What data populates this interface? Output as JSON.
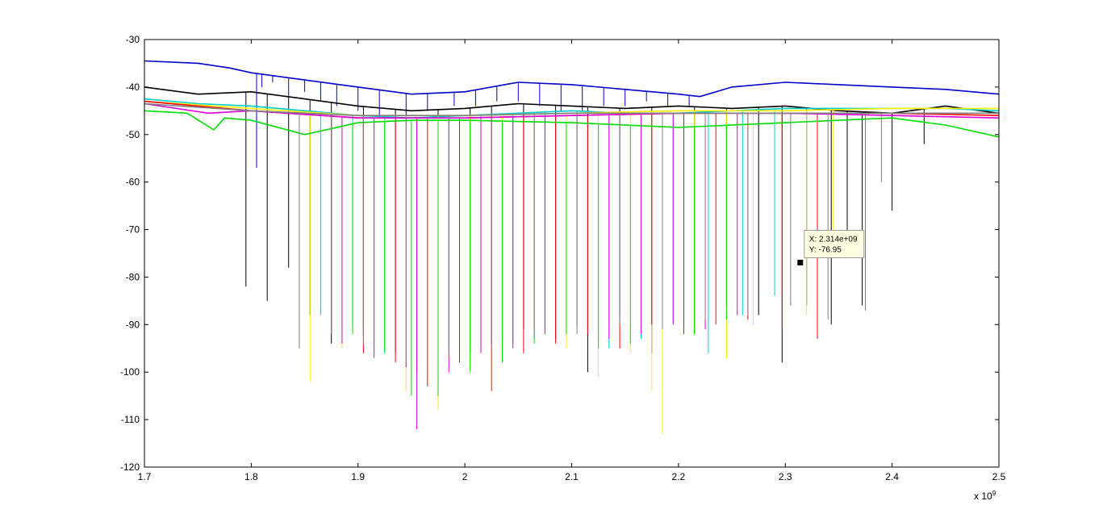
{
  "chart_data": {
    "type": "line",
    "title": "",
    "xlabel": "",
    "ylabel": "",
    "xlim": [
      1.7,
      2.5
    ],
    "ylim": [
      -120,
      -30
    ],
    "x_exponent_label": "x 10",
    "x_exponent_power": "9",
    "x_ticks": [
      "1.7",
      "1.8",
      "1.9",
      "2",
      "2.1",
      "2.2",
      "2.3",
      "2.4",
      "2.5"
    ],
    "y_ticks": [
      "-30",
      "-40",
      "-50",
      "-60",
      "-70",
      "-80",
      "-90",
      "-100",
      "-110",
      "-120"
    ],
    "grid": false,
    "legend": "none",
    "series": [
      {
        "color": "#0000cc",
        "baseline": [
          [
            1.7,
            -34.5
          ],
          [
            1.75,
            -35.0
          ],
          [
            1.78,
            -36.0
          ],
          [
            1.8,
            -37.0
          ],
          [
            1.85,
            -38.5
          ],
          [
            1.9,
            -40.0
          ],
          [
            1.95,
            -41.5
          ],
          [
            2.0,
            -41.0
          ],
          [
            2.05,
            -39.0
          ],
          [
            2.1,
            -39.5
          ],
          [
            2.15,
            -40.5
          ],
          [
            2.2,
            -41.5
          ],
          [
            2.22,
            -42.0
          ],
          [
            2.25,
            -40.0
          ],
          [
            2.3,
            -39.0
          ],
          [
            2.35,
            -39.5
          ],
          [
            2.4,
            -40.0
          ],
          [
            2.45,
            -40.5
          ],
          [
            2.5,
            -41.5
          ]
        ],
        "dips": [
          [
            1.805,
            -57
          ],
          [
            1.81,
            -40
          ],
          [
            1.82,
            -39
          ],
          [
            1.835,
            -42
          ],
          [
            1.85,
            -41
          ],
          [
            1.865,
            -43
          ],
          [
            1.88,
            -44
          ],
          [
            1.9,
            -45
          ],
          [
            1.92,
            -46
          ],
          [
            1.945,
            -46
          ],
          [
            1.965,
            -45
          ],
          [
            1.99,
            -44
          ],
          [
            2.01,
            -44
          ],
          [
            2.03,
            -43
          ],
          [
            2.05,
            -43
          ],
          [
            2.07,
            -44
          ],
          [
            2.09,
            -45
          ],
          [
            2.11,
            -45
          ],
          [
            2.13,
            -44
          ],
          [
            2.15,
            -44
          ],
          [
            2.17,
            -43
          ],
          [
            2.19,
            -44
          ],
          [
            2.21,
            -44
          ]
        ]
      },
      {
        "color": "#000000",
        "baseline": [
          [
            1.7,
            -40.0
          ],
          [
            1.75,
            -41.5
          ],
          [
            1.8,
            -41.0
          ],
          [
            1.85,
            -42.5
          ],
          [
            1.9,
            -44.0
          ],
          [
            1.95,
            -45.0
          ],
          [
            2.0,
            -44.5
          ],
          [
            2.05,
            -43.5
          ],
          [
            2.1,
            -44.0
          ],
          [
            2.15,
            -44.5
          ],
          [
            2.2,
            -44.0
          ],
          [
            2.25,
            -44.5
          ],
          [
            2.3,
            -44.0
          ],
          [
            2.35,
            -45.0
          ],
          [
            2.4,
            -45.5
          ],
          [
            2.45,
            -44.0
          ],
          [
            2.5,
            -45.5
          ]
        ],
        "dips": [
          [
            1.795,
            -82
          ],
          [
            1.815,
            -85
          ],
          [
            1.835,
            -78
          ],
          [
            1.855,
            -88
          ],
          [
            1.875,
            -94
          ],
          [
            1.905,
            -92
          ],
          [
            1.935,
            -96
          ],
          [
            1.975,
            -101
          ],
          [
            2.005,
            -96
          ],
          [
            2.025,
            -94
          ],
          [
            2.055,
            -91
          ],
          [
            2.085,
            -93
          ],
          [
            2.115,
            -100
          ],
          [
            2.145,
            -88
          ],
          [
            2.175,
            -96
          ],
          [
            2.215,
            -92
          ],
          [
            2.245,
            -86
          ],
          [
            2.275,
            -88
          ],
          [
            2.297,
            -98
          ],
          [
            2.32,
            -86
          ],
          [
            2.343,
            -90
          ],
          [
            2.358,
            -76
          ],
          [
            2.372,
            -86
          ],
          [
            2.4,
            -66
          ],
          [
            2.43,
            -52
          ]
        ]
      },
      {
        "color": "#00cccc",
        "baseline": [
          [
            1.7,
            -42.5
          ],
          [
            1.75,
            -43.5
          ],
          [
            1.8,
            -44.0
          ],
          [
            1.85,
            -45.0
          ],
          [
            1.9,
            -46.0
          ],
          [
            1.95,
            -46.5
          ],
          [
            2.0,
            -46.0
          ],
          [
            2.05,
            -45.5
          ],
          [
            2.1,
            -45.0
          ],
          [
            2.15,
            -45.5
          ],
          [
            2.2,
            -45.5
          ],
          [
            2.25,
            -45.0
          ],
          [
            2.3,
            -44.5
          ],
          [
            2.35,
            -44.5
          ],
          [
            2.4,
            -44.5
          ],
          [
            2.45,
            -44.5
          ],
          [
            2.5,
            -45.0
          ]
        ],
        "dips": [
          [
            1.865,
            -88
          ],
          [
            1.895,
            -90
          ],
          [
            1.925,
            -96
          ],
          [
            1.955,
            -98
          ],
          [
            1.985,
            -95
          ],
          [
            2.015,
            -92
          ],
          [
            2.045,
            -94
          ],
          [
            2.075,
            -91
          ],
          [
            2.105,
            -89
          ],
          [
            2.135,
            -95
          ],
          [
            2.165,
            -93
          ],
          [
            2.195,
            -90
          ],
          [
            2.228,
            -96
          ],
          [
            2.26,
            -88
          ],
          [
            2.29,
            -84
          ]
        ]
      },
      {
        "color": "#ffee00",
        "baseline": [
          [
            1.7,
            -43.0
          ],
          [
            1.8,
            -44.5
          ],
          [
            1.9,
            -46.0
          ],
          [
            2.0,
            -46.0
          ],
          [
            2.1,
            -45.5
          ],
          [
            2.2,
            -45.0
          ],
          [
            2.3,
            -45.0
          ],
          [
            2.4,
            -44.5
          ],
          [
            2.5,
            -44.5
          ]
        ],
        "dips": [
          [
            1.855,
            -102
          ],
          [
            1.885,
            -95
          ],
          [
            1.915,
            -97
          ],
          [
            1.945,
            -104
          ],
          [
            1.975,
            -108
          ],
          [
            2.005,
            -99
          ],
          [
            2.035,
            -96
          ],
          [
            2.065,
            -91
          ],
          [
            2.095,
            -95
          ],
          [
            2.125,
            -101
          ],
          [
            2.155,
            -96
          ],
          [
            2.175,
            -104
          ],
          [
            2.185,
            -113
          ],
          [
            2.215,
            -92
          ],
          [
            2.245,
            -97
          ],
          [
            2.27,
            -90
          ],
          [
            2.32,
            -88
          ],
          [
            2.345,
            -70
          ]
        ]
      },
      {
        "color": "#ff0000",
        "baseline": [
          [
            1.7,
            -43.0
          ],
          [
            1.8,
            -45.0
          ],
          [
            1.9,
            -46.5
          ],
          [
            2.0,
            -46.5
          ],
          [
            2.1,
            -46.0
          ],
          [
            2.2,
            -45.5
          ],
          [
            2.3,
            -45.5
          ],
          [
            2.4,
            -45.5
          ],
          [
            2.5,
            -46.0
          ]
        ],
        "dips": [
          [
            1.875,
            -92
          ],
          [
            1.905,
            -96
          ],
          [
            1.935,
            -98
          ],
          [
            1.955,
            -100
          ],
          [
            1.965,
            -103
          ],
          [
            1.995,
            -98
          ],
          [
            2.025,
            -104
          ],
          [
            2.055,
            -96
          ],
          [
            2.085,
            -94
          ],
          [
            2.115,
            -92
          ],
          [
            2.145,
            -95
          ],
          [
            2.175,
            -90
          ],
          [
            2.205,
            -92
          ],
          [
            2.235,
            -90
          ],
          [
            2.265,
            -89
          ],
          [
            2.297,
            -91
          ],
          [
            2.33,
            -93
          ]
        ]
      },
      {
        "color": "#dd00dd",
        "baseline": [
          [
            1.7,
            -43.5
          ],
          [
            1.76,
            -45.5
          ],
          [
            1.8,
            -45.0
          ],
          [
            1.9,
            -46.5
          ],
          [
            2.0,
            -46.5
          ],
          [
            2.1,
            -46.0
          ],
          [
            2.2,
            -45.5
          ],
          [
            2.3,
            -45.5
          ],
          [
            2.4,
            -46.0
          ],
          [
            2.5,
            -46.5
          ]
        ],
        "dips": [
          [
            1.885,
            -94
          ],
          [
            1.915,
            -97
          ],
          [
            1.945,
            -99
          ],
          [
            1.955,
            -112
          ],
          [
            1.985,
            -100
          ],
          [
            2.015,
            -96
          ],
          [
            2.045,
            -95
          ],
          [
            2.075,
            -92
          ],
          [
            2.105,
            -90
          ],
          [
            2.135,
            -93
          ],
          [
            2.165,
            -92
          ],
          [
            2.195,
            -90
          ],
          [
            2.225,
            -91
          ],
          [
            2.255,
            -88
          ]
        ]
      },
      {
        "color": "#00dd00",
        "baseline": [
          [
            1.7,
            -45.0
          ],
          [
            1.74,
            -45.5
          ],
          [
            1.765,
            -49.0
          ],
          [
            1.775,
            -46.5
          ],
          [
            1.8,
            -47.0
          ],
          [
            1.85,
            -50.0
          ],
          [
            1.9,
            -47.5
          ],
          [
            1.95,
            -47.0
          ],
          [
            2.0,
            -47.0
          ],
          [
            2.1,
            -47.5
          ],
          [
            2.2,
            -48.5
          ],
          [
            2.3,
            -47.5
          ],
          [
            2.35,
            -47.0
          ],
          [
            2.4,
            -46.5
          ],
          [
            2.45,
            -48.0
          ],
          [
            2.5,
            -50.5
          ]
        ],
        "dips": [
          [
            1.895,
            -92
          ],
          [
            1.925,
            -96
          ],
          [
            1.95,
            -105
          ],
          [
            1.975,
            -105
          ],
          [
            2.005,
            -100
          ],
          [
            2.035,
            -98
          ],
          [
            2.065,
            -94
          ],
          [
            2.095,
            -92
          ],
          [
            2.125,
            -95
          ],
          [
            2.155,
            -94
          ],
          [
            2.185,
            -91
          ],
          [
            2.215,
            -92
          ],
          [
            2.245,
            -89
          ]
        ]
      },
      {
        "color": "#808080",
        "baseline": [
          [
            1.7,
            -43.5
          ],
          [
            1.8,
            -45.0
          ],
          [
            1.9,
            -46.0
          ],
          [
            2.0,
            -46.0
          ],
          [
            2.1,
            -45.5
          ],
          [
            2.2,
            -45.5
          ],
          [
            2.3,
            -45.5
          ],
          [
            2.4,
            -45.5
          ],
          [
            2.5,
            -45.5
          ]
        ],
        "dips": [
          [
            1.845,
            -95
          ],
          [
            1.875,
            -92
          ],
          [
            1.905,
            -94
          ],
          [
            1.945,
            -98
          ],
          [
            1.985,
            -97
          ],
          [
            2.025,
            -95
          ],
          [
            2.065,
            -93
          ],
          [
            2.105,
            -92
          ],
          [
            2.145,
            -90
          ],
          [
            2.185,
            -91
          ],
          [
            2.225,
            -89
          ],
          [
            2.265,
            -88
          ],
          [
            2.305,
            -86
          ],
          [
            2.34,
            -89
          ],
          [
            2.375,
            -87
          ],
          [
            2.39,
            -60
          ]
        ]
      }
    ],
    "data_tip": {
      "x_label": "X: 2.314e+09",
      "y_label": "Y: -76.95",
      "x": 2.314,
      "y": -76.95
    }
  }
}
